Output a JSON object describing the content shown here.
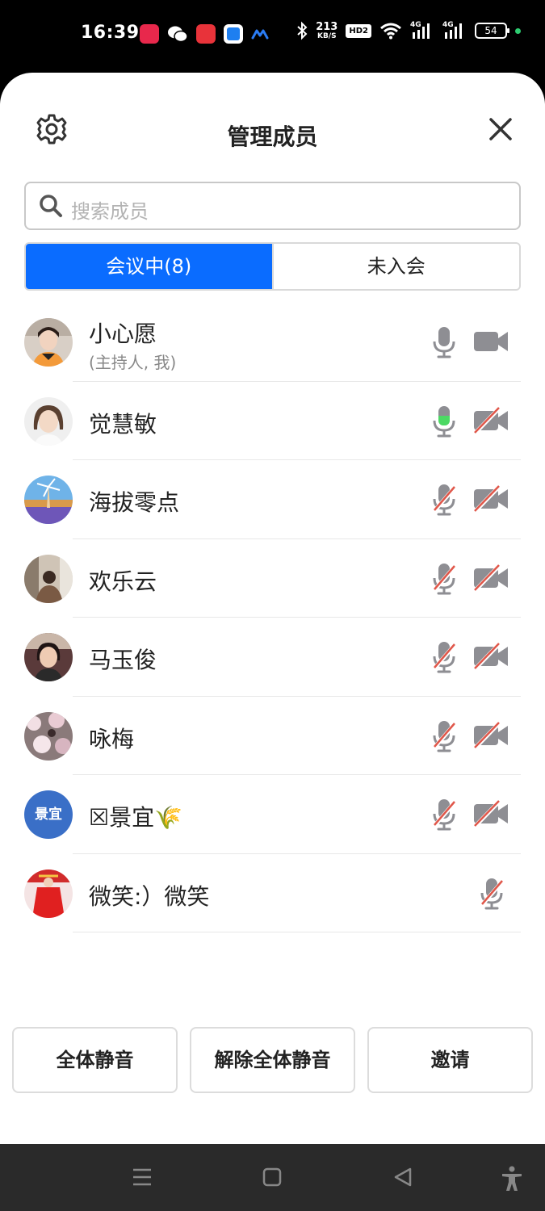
{
  "status_bar": {
    "time": "16:39",
    "net_speed_value": "213",
    "net_speed_unit": "KB/S",
    "hd_label": "HD2",
    "signal1_label": "4G",
    "signal2_label": "4G",
    "battery": "54",
    "icons": [
      "app-icon-qq",
      "wechat-icon",
      "toutiao-icon",
      "app-icon-blue",
      "meeting-app-icon",
      "bluetooth-icon",
      "wifi-icon",
      "signal-icon",
      "battery-icon"
    ]
  },
  "header": {
    "title": "管理成员",
    "settings_icon": "gear-icon",
    "close_icon": "close-icon"
  },
  "search": {
    "placeholder": "搜索成员"
  },
  "tabs": [
    {
      "label": "会议中(8)",
      "active": true
    },
    {
      "label": "未入会",
      "active": false
    }
  ],
  "members": [
    {
      "name": "小心愿",
      "subtitle": "(主持人, 我)",
      "avatar": "photo",
      "mic": "on",
      "camera": "on"
    },
    {
      "name": "觉慧敏",
      "avatar": "photo",
      "mic": "speaking",
      "camera": "off"
    },
    {
      "name": "海拔零点",
      "avatar": "photo",
      "mic": "off",
      "camera": "off"
    },
    {
      "name": "欢乐云",
      "avatar": "photo",
      "mic": "off",
      "camera": "off"
    },
    {
      "name": "马玉俊",
      "avatar": "photo",
      "mic": "off",
      "camera": "off"
    },
    {
      "name": "咏梅",
      "avatar": "photo",
      "mic": "off",
      "camera": "off"
    },
    {
      "name": "☒景宜🌾",
      "avatar_text": "景宜",
      "avatar": "text",
      "mic": "off",
      "camera": "off"
    },
    {
      "name": "微笑:）微笑",
      "avatar": "photo",
      "mic": "off",
      "camera": "none"
    }
  ],
  "actions": {
    "mute_all": "全体静音",
    "unmute_all": "解除全体静音",
    "invite": "邀请"
  },
  "colors": {
    "accent": "#0a6cff",
    "mic_speaking": "#4cd964",
    "muted_slash": "#e0574a",
    "icon_gray": "#8e8e93"
  }
}
